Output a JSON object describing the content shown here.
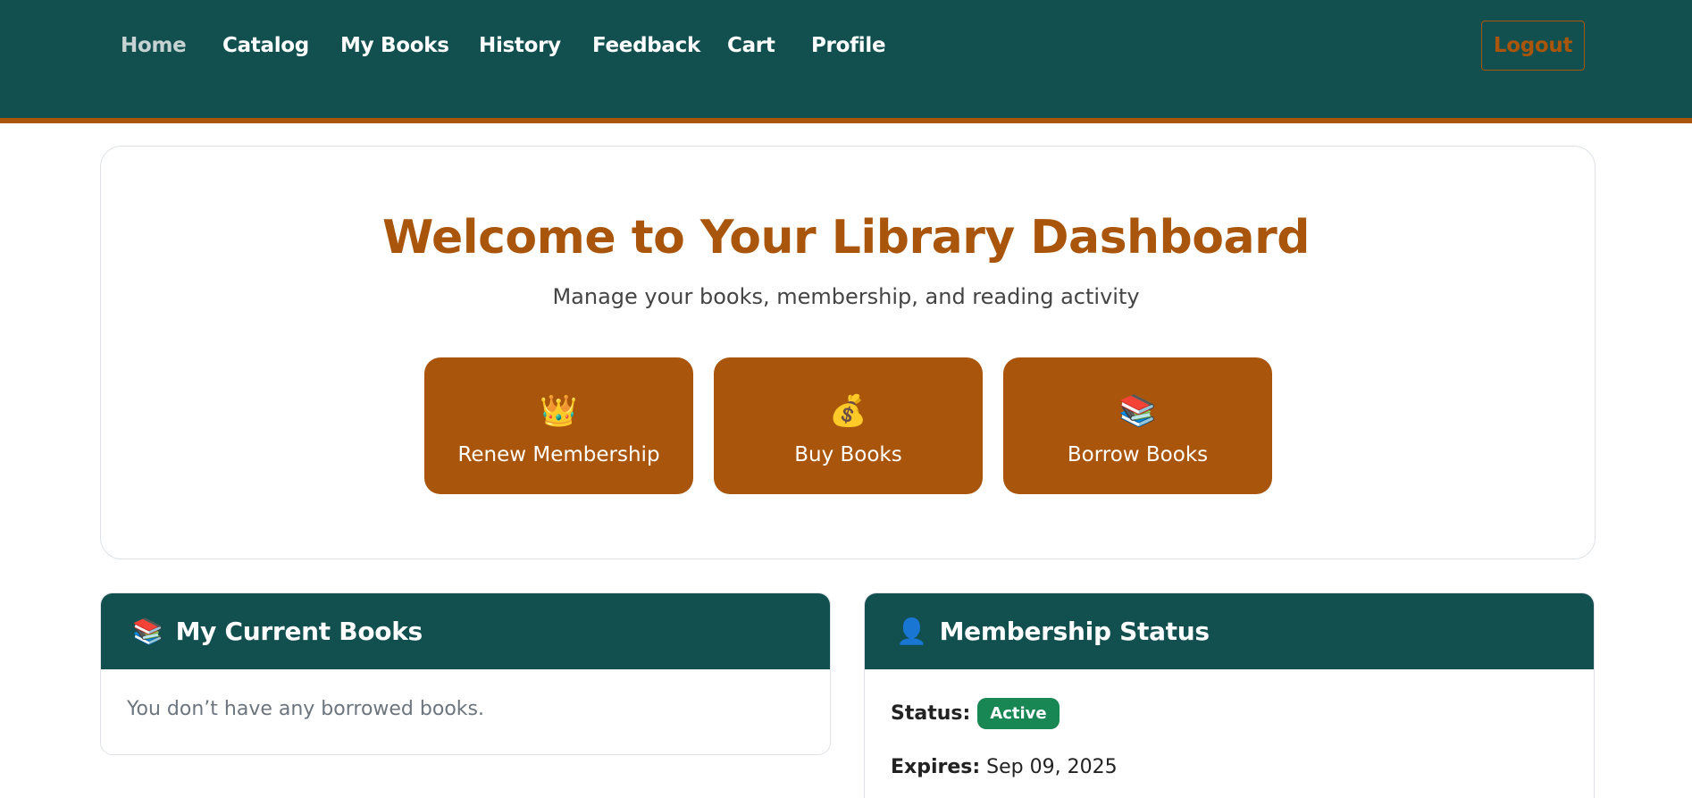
{
  "nav": {
    "items": [
      {
        "label": "Home",
        "active": true
      },
      {
        "label": "Catalog"
      },
      {
        "label": "My Books"
      },
      {
        "label": "History"
      },
      {
        "label": "Feedback"
      },
      {
        "label": "Cart"
      },
      {
        "label": "Profile"
      }
    ],
    "logout_label": "Logout"
  },
  "hero": {
    "title": "Welcome to Your Library Dashboard",
    "subtitle": "Manage your books, membership, and reading activity",
    "actions": [
      {
        "icon": "👑",
        "icon_name": "crown-icon",
        "label": "Renew Membership"
      },
      {
        "icon": "💰",
        "icon_name": "money-bag-icon",
        "label": "Buy Books"
      },
      {
        "icon": "📚",
        "icon_name": "books-icon",
        "label": "Borrow Books"
      }
    ]
  },
  "current_books": {
    "icon": "📚",
    "icon_name": "books-icon",
    "title": "My Current Books",
    "empty_message": "You don’t have any borrowed books."
  },
  "membership": {
    "icon": "👤",
    "icon_name": "user-icon",
    "title": "Membership Status",
    "status_label": "Status:",
    "status_value": "Active",
    "expires_label": "Expires:",
    "expires_value": "Sep 09, 2025"
  },
  "colors": {
    "primary": "#124f4f",
    "accent": "#a9550b",
    "success": "#198754"
  }
}
